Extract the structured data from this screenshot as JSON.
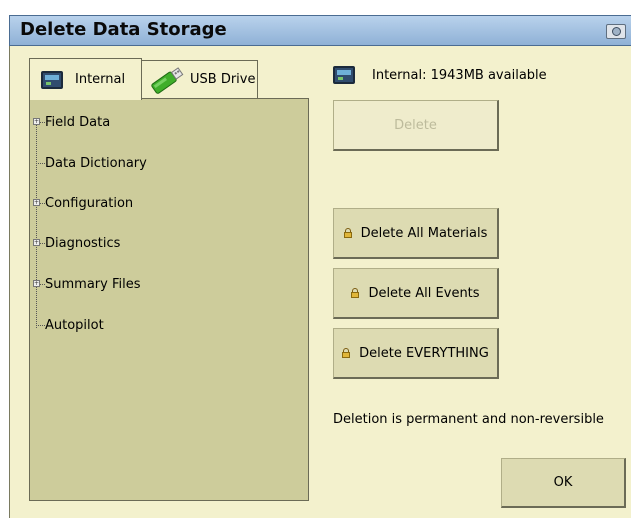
{
  "window": {
    "title": "Delete Data Storage",
    "camera_icon": "camera-icon"
  },
  "tabs": [
    {
      "label": "Internal",
      "icon": "internal-storage-icon"
    },
    {
      "label": "USB Drive",
      "icon": "usb-drive-icon"
    }
  ],
  "tree": {
    "items": [
      {
        "label": "Field Data",
        "expandable": true
      },
      {
        "label": "Data Dictionary",
        "expandable": false
      },
      {
        "label": "Configuration",
        "expandable": true
      },
      {
        "label": "Diagnostics",
        "expandable": true
      },
      {
        "label": "Summary Files",
        "expandable": true
      },
      {
        "label": "Autopilot",
        "expandable": false
      }
    ]
  },
  "storage": {
    "status": "Internal: 1943MB available"
  },
  "buttons": {
    "delete": "Delete",
    "delete_all_materials": "Delete All Materials",
    "delete_all_events": "Delete All Events",
    "delete_everything": "Delete EVERYTHING",
    "ok": "OK"
  },
  "note": "Deletion is permanent and non-reversible"
}
